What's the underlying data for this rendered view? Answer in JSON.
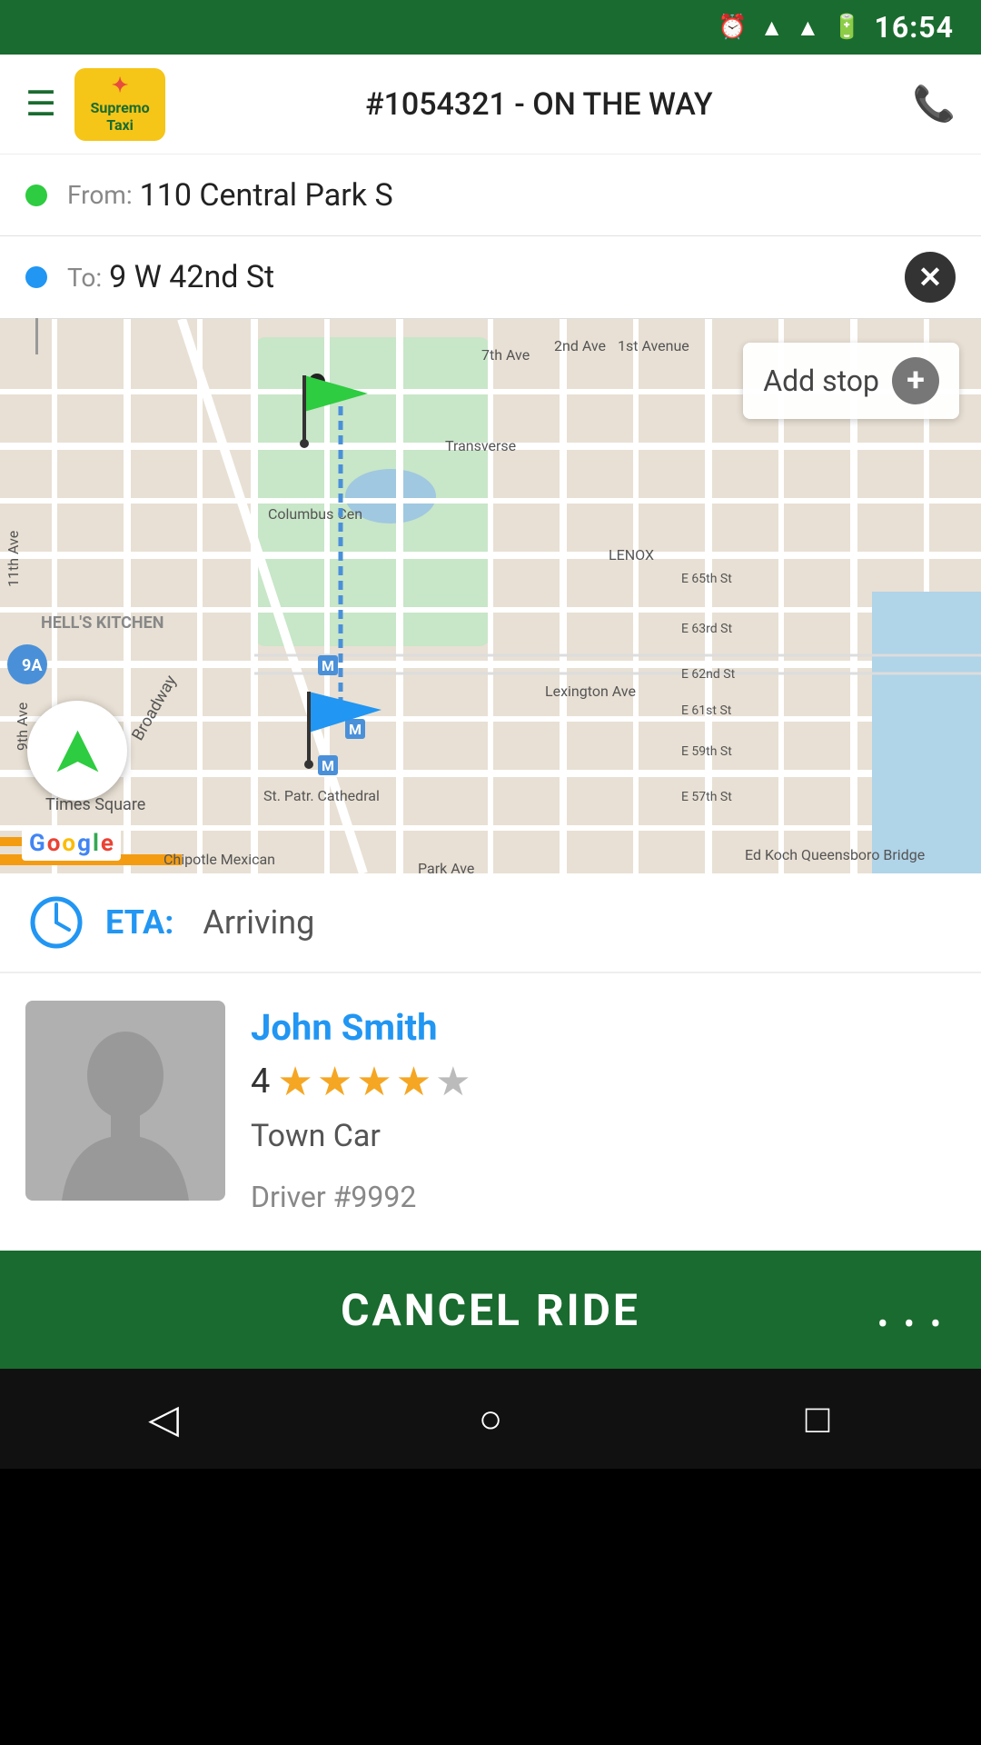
{
  "statusBar": {
    "time": "16:54",
    "icons": [
      "alarm",
      "wifi",
      "signal",
      "battery"
    ]
  },
  "appBar": {
    "menuLabel": "☰",
    "logoText": "Supremo\nTaxi",
    "title": "#1054321 - ON THE WAY",
    "phoneIcon": "📞"
  },
  "route": {
    "fromLabel": "From:",
    "fromAddress": "110 Central Park S",
    "toLabel": "To:",
    "toAddress": "9 W 42nd St"
  },
  "map": {
    "addStopLabel": "Add stop"
  },
  "eta": {
    "label": "ETA:",
    "value": "Arriving"
  },
  "driver": {
    "name": "John Smith",
    "rating": "4",
    "stars": [
      true,
      true,
      true,
      true,
      false
    ],
    "vehicle": "Town Car",
    "driverNumber": "Driver #9992"
  },
  "cancelBtn": {
    "label": "CANCEL RIDE",
    "moreLabel": "• • •"
  },
  "navBar": {
    "back": "◁",
    "home": "○",
    "recent": "□"
  }
}
